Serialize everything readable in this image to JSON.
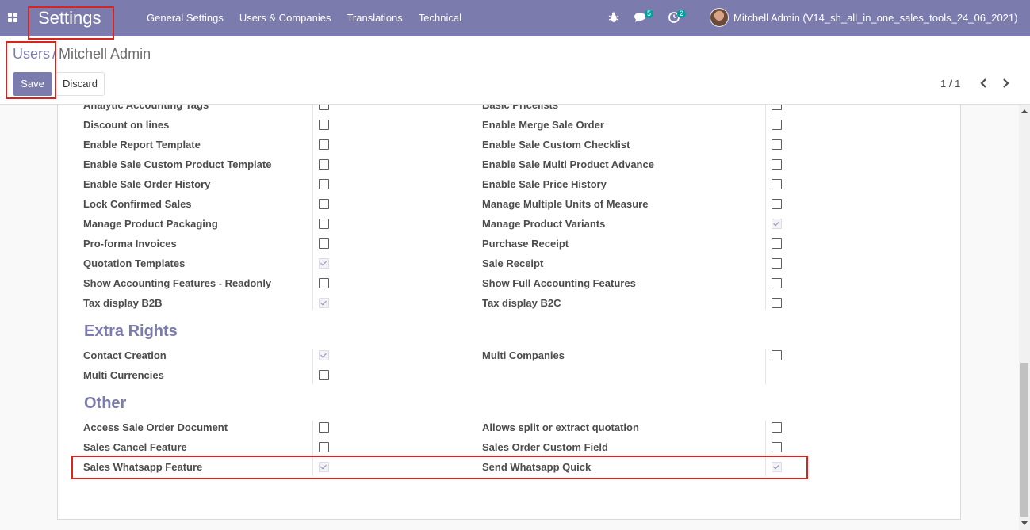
{
  "app": {
    "brand": "Settings",
    "menu": [
      "General Settings",
      "Users & Companies",
      "Translations",
      "Technical"
    ],
    "messages_count": "5",
    "activities_count": "2",
    "user_name": "Mitchell Admin (V14_sh_all_in_one_sales_tools_24_06_2021)"
  },
  "breadcrumb": {
    "parent": "Users",
    "separator": "/",
    "current": "Mitchell Admin"
  },
  "toolbar": {
    "save_label": "Save",
    "discard_label": "Discard"
  },
  "pager": {
    "value": "1 / 1"
  },
  "sales_rights": {
    "left": [
      {
        "label": "Analytic Accounting Tags",
        "checked": false
      },
      {
        "label": "Discount on lines",
        "checked": false
      },
      {
        "label": "Enable Report Template",
        "checked": false
      },
      {
        "label": "Enable Sale Custom Product Template",
        "checked": false
      },
      {
        "label": "Enable Sale Order History",
        "checked": false
      },
      {
        "label": "Lock Confirmed Sales",
        "checked": false
      },
      {
        "label": "Manage Product Packaging",
        "checked": false
      },
      {
        "label": "Pro-forma Invoices",
        "checked": false
      },
      {
        "label": "Quotation Templates",
        "checked": true
      },
      {
        "label": "Show Accounting Features - Readonly",
        "checked": false
      },
      {
        "label": "Tax display B2B",
        "checked": true
      }
    ],
    "right": [
      {
        "label": "Basic Pricelists",
        "checked": false
      },
      {
        "label": "Enable Merge Sale Order",
        "checked": false
      },
      {
        "label": "Enable Sale Custom Checklist",
        "checked": false
      },
      {
        "label": "Enable Sale Multi Product Advance",
        "checked": false
      },
      {
        "label": "Enable Sale Price History",
        "checked": false
      },
      {
        "label": "Manage Multiple Units of Measure",
        "checked": false
      },
      {
        "label": "Manage Product Variants",
        "checked": true
      },
      {
        "label": "Purchase Receipt",
        "checked": false
      },
      {
        "label": "Sale Receipt",
        "checked": false
      },
      {
        "label": "Show Full Accounting Features",
        "checked": false
      },
      {
        "label": "Tax display B2C",
        "checked": false
      }
    ]
  },
  "extra_rights": {
    "title": "Extra Rights",
    "left": [
      {
        "label": "Contact Creation",
        "checked": true
      },
      {
        "label": "Multi Currencies",
        "checked": false
      }
    ],
    "right": [
      {
        "label": "Multi Companies",
        "checked": false
      }
    ]
  },
  "other": {
    "title": "Other",
    "left": [
      {
        "label": "Access Sale Order Document",
        "checked": false
      },
      {
        "label": "Sales Cancel Feature",
        "checked": false
      },
      {
        "label": "Sales Whatsapp Feature",
        "checked": true
      }
    ],
    "right": [
      {
        "label": "Allows split or extract quotation",
        "checked": false
      },
      {
        "label": "Sales Order Custom Field",
        "checked": false
      },
      {
        "label": "Send Whatsapp Quick",
        "checked": true
      }
    ]
  },
  "colors": {
    "navbar": "#7c7bad",
    "accent": "#7c7bad",
    "highlight": "#d9231d"
  }
}
